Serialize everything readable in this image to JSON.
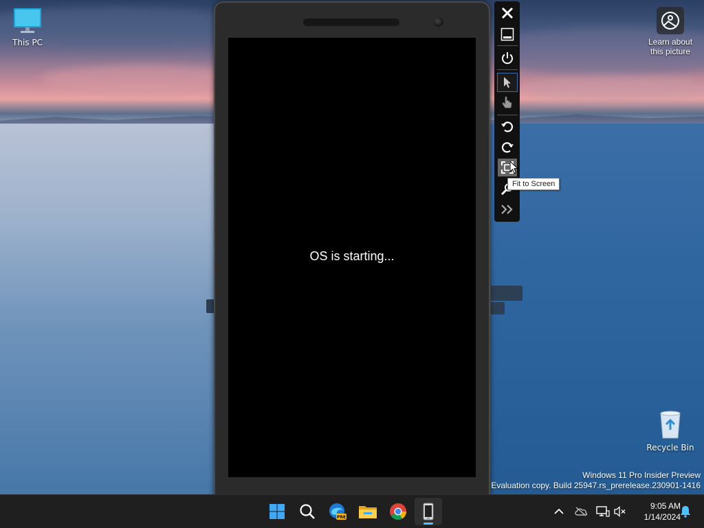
{
  "desktop": {
    "icons": [
      {
        "label": "This PC"
      },
      {
        "label": "Recycle Bin"
      }
    ],
    "learn_about": {
      "line1": "Learn about",
      "line2": "this picture"
    },
    "watermark": {
      "line1": "Windows 11 Pro Insider Preview",
      "line2": "Evaluation copy. Build 25947.rs_prerelease.230901-1416"
    }
  },
  "emulator": {
    "screen_text": "OS is starting...",
    "toolbar": {
      "buttons": [
        {
          "icon": "close-icon"
        },
        {
          "icon": "minimize-icon"
        },
        {
          "icon": "power-icon"
        },
        {
          "icon": "mouse-input-icon",
          "state": "selected"
        },
        {
          "icon": "touch-input-icon"
        },
        {
          "icon": "rotate-left-icon"
        },
        {
          "icon": "rotate-right-icon"
        },
        {
          "icon": "fit-to-screen-icon",
          "state": "hover"
        },
        {
          "icon": "zoom-icon"
        },
        {
          "icon": "more-tools-icon"
        }
      ],
      "tooltip": "Fit to Screen"
    }
  },
  "taskbar": {
    "apps": [
      {
        "icon": "windows-start-icon"
      },
      {
        "icon": "search-icon"
      },
      {
        "icon": "edge-preview-icon",
        "badge": "PRE"
      },
      {
        "icon": "file-explorer-icon"
      },
      {
        "icon": "chrome-icon"
      },
      {
        "icon": "phone-emulator-icon",
        "state": "active"
      }
    ],
    "tray": {
      "time": "9:05 AM",
      "date": "1/14/2024"
    }
  },
  "colors": {
    "accent": "#4cc2ff",
    "taskbar_bg": "#1f1f1f",
    "toolbar_bg": "#111111",
    "screen_bg": "#000000"
  }
}
